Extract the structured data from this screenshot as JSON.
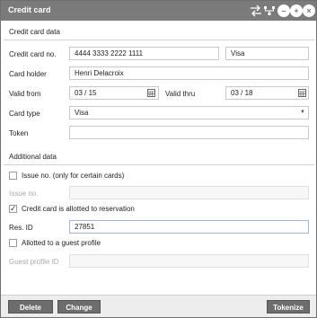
{
  "window": {
    "title": "Credit card"
  },
  "credit_card_data": {
    "section_title": "Credit card data",
    "card_no_label": "Credit card no.",
    "card_no_value": "4444 3333 2222 1111",
    "card_brand_value": "Visa",
    "card_holder_label": "Card holder",
    "card_holder_value": "Henri Delacroix",
    "valid_from_label": "Valid from",
    "valid_from_value": "03 / 15",
    "valid_thru_label": "Valid thru",
    "valid_thru_value": "03 / 18",
    "card_type_label": "Card type",
    "card_type_value": "Visa",
    "token_label": "Token",
    "token_value": ""
  },
  "additional_data": {
    "section_title": "Additional data",
    "issue_no_checkbox_label": "Issue no. (only for certain cards)",
    "issue_no_checked": false,
    "issue_no_label": "Issue no.",
    "issue_no_value": "",
    "allotted_checkbox_label": "Credit card is allotted to reservation",
    "allotted_checked": true,
    "res_id_label": "Res. ID",
    "res_id_value": "27851",
    "guest_profile_checkbox_label": "Allotted to a guest profile",
    "guest_profile_checked": false,
    "guest_profile_id_label": "Guest profile ID",
    "guest_profile_id_value": ""
  },
  "footer": {
    "delete_label": "Delete",
    "change_label": "Change",
    "tokenize_label": "Tokenize"
  },
  "colors": {
    "titlebar": "#7b7b7b",
    "button": "#6d6d6d",
    "footer": "#ededed"
  }
}
